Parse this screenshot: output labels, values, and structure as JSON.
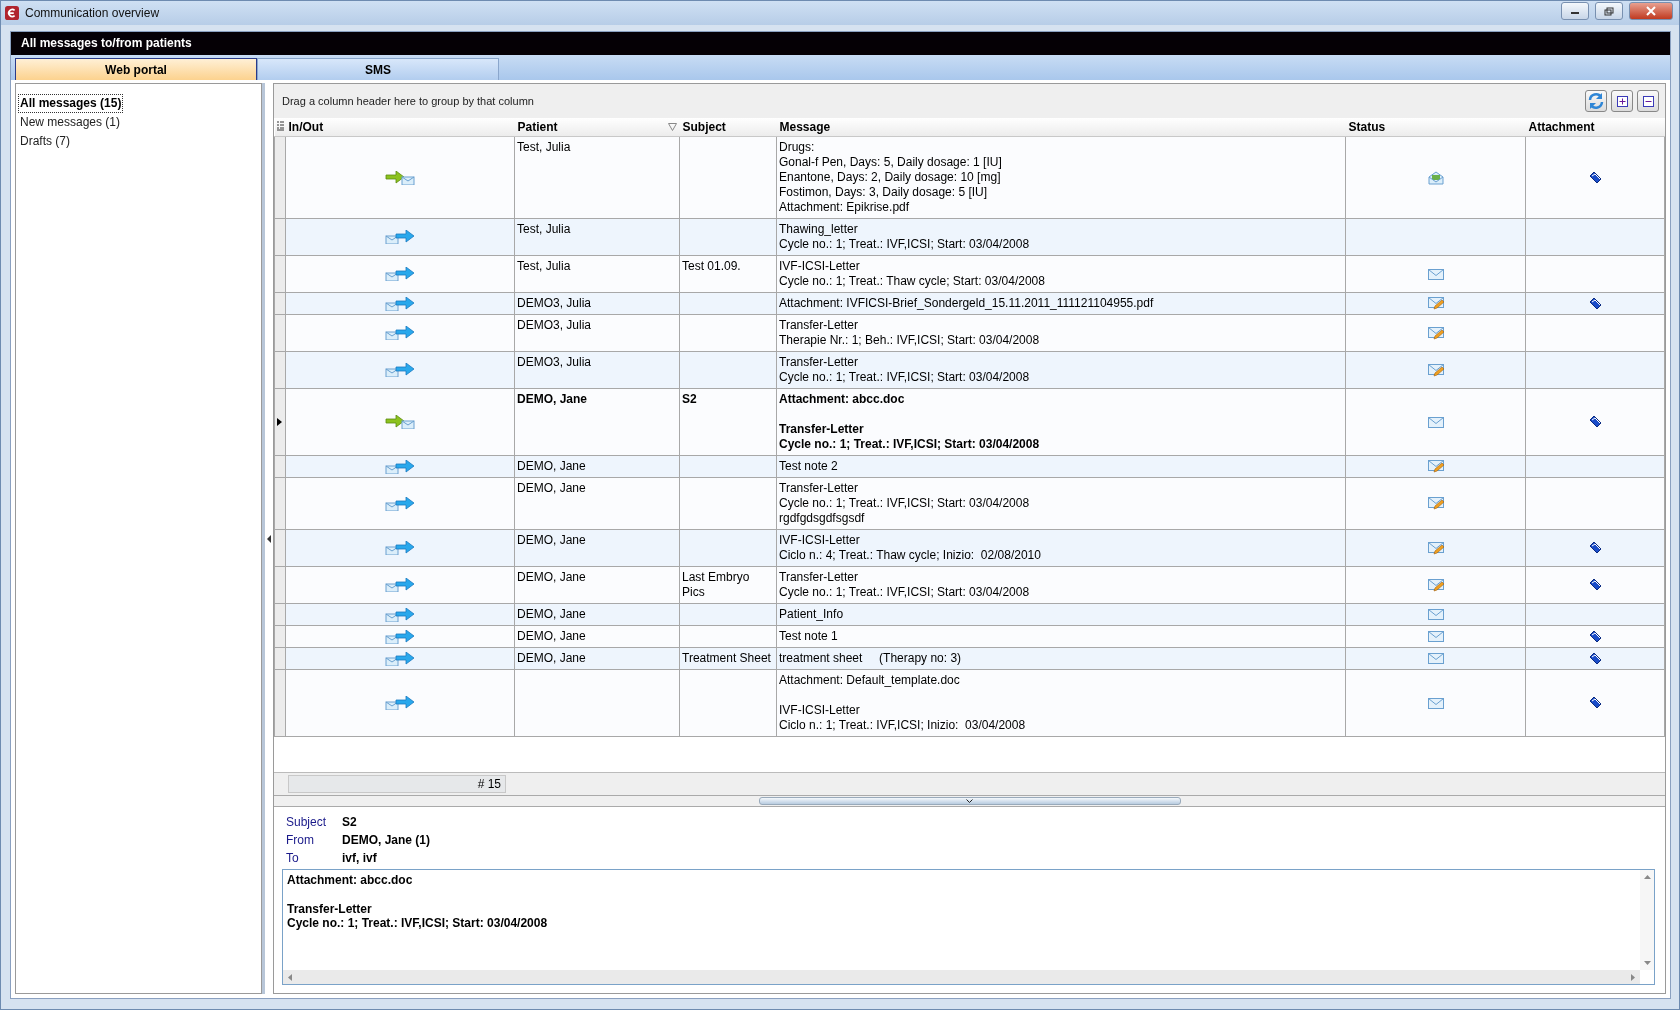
{
  "window": {
    "title": "Communication overview"
  },
  "header": "All messages to/from patients",
  "tabs": [
    {
      "label": "Web portal",
      "selected": true
    },
    {
      "label": "SMS",
      "selected": false
    }
  ],
  "folders": [
    {
      "label": "All messages (15)",
      "selected": true
    },
    {
      "label": "New messages (1)",
      "selected": false
    },
    {
      "label": "Drafts (7)",
      "selected": false
    }
  ],
  "group_hint": "Drag a column header here to group by that column",
  "table": {
    "columns": [
      "In/Out",
      "Patient",
      "Subject",
      "Message",
      "Status",
      "Attachment"
    ],
    "rows": [
      {
        "kind": "incoming",
        "patient": "Test, Julia",
        "message": [
          [
            "Drugs:",
            "Gonal-f Pen, Days: 5, Daily dosage: 1 [IU]",
            "Enantone, Days: 2, Daily dosage: 10 [mg]",
            "Fostimon, Days: 3, Daily dosage: 5 [IU]",
            "Attachment: Epikrise.pdf"
          ]
        ],
        "status": {
          "kind": "opened"
        },
        "attachment": true,
        "unread": false,
        "selected": false
      },
      {
        "kind": "outgoing",
        "patient": "Test, Julia",
        "message": [
          [
            "Thawing_letter",
            "Cycle no.: 1; Treat.: IVF,ICSI; Start: 03/04/2008"
          ]
        ],
        "attachment": false,
        "unread": false,
        "selected": false
      },
      {
        "kind": "outgoing",
        "patient": "Test, Julia",
        "subject": "Test 01.09.",
        "message": [
          [
            "IVF-ICSI-Letter",
            "Cycle no.: 1; Treat.: Thaw cycle; Start: 03/04/2008"
          ]
        ],
        "status": {
          "kind": "envelope"
        },
        "attachment": false,
        "unread": false,
        "selected": false
      },
      {
        "kind": "outgoing",
        "patient": "DEMO3, Julia",
        "message": [
          [
            "Attachment: IVFICSI-Brief_Sondergeld_15.11.2011_111121104955.pdf"
          ]
        ],
        "status": {
          "kind": "draft"
        },
        "attachment": true,
        "unread": false,
        "selected": false
      },
      {
        "kind": "outgoing",
        "patient": "DEMO3, Julia",
        "message": [
          [
            "Transfer-Letter",
            "Therapie Nr.: 1; Beh.: IVF,ICSI; Start: 03/04/2008"
          ]
        ],
        "status": {
          "kind": "draft"
        },
        "attachment": false,
        "unread": false,
        "selected": false
      },
      {
        "kind": "outgoing",
        "patient": "DEMO3, Julia",
        "message": [
          [
            "Transfer-Letter",
            "Cycle no.: 1; Treat.: IVF,ICSI; Start: 03/04/2008"
          ]
        ],
        "status": {
          "kind": "draft"
        },
        "attachment": false,
        "unread": false,
        "selected": false
      },
      {
        "kind": "incoming",
        "patient": "DEMO, Jane",
        "subject": "S2",
        "message": [
          [
            "Attachment: abcc.doc"
          ],
          [
            "Transfer-Letter",
            "Cycle no.: 1; Treat.: IVF,ICSI; Start: 03/04/2008"
          ]
        ],
        "status": {
          "kind": "envelope"
        },
        "attachment": true,
        "unread": true,
        "selected": true
      },
      {
        "kind": "outgoing",
        "patient": "DEMO, Jane",
        "message": [
          [
            "Test note 2"
          ]
        ],
        "status": {
          "kind": "draft"
        },
        "attachment": false,
        "unread": false,
        "selected": false
      },
      {
        "kind": "outgoing",
        "patient": "DEMO, Jane",
        "message": [
          [
            "Transfer-Letter",
            "Cycle no.: 1; Treat.: IVF,ICSI; Start: 03/04/2008",
            "rgdfgdsgdfsgsdf"
          ]
        ],
        "status": {
          "kind": "draft"
        },
        "attachment": false,
        "unread": false,
        "selected": false
      },
      {
        "kind": "outgoing",
        "patient": "DEMO, Jane",
        "message": [
          [
            "IVF-ICSI-Letter",
            "Ciclo n.: 4; Treat.: Thaw cycle; Inizio:  02/08/2010"
          ]
        ],
        "status": {
          "kind": "draft"
        },
        "attachment": true,
        "unread": false,
        "selected": false
      },
      {
        "kind": "outgoing",
        "patient": "DEMO, Jane",
        "subject": "Last Embryo Pics",
        "message": [
          [
            "Transfer-Letter",
            "Cycle no.: 1; Treat.: IVF,ICSI; Start: 03/04/2008"
          ]
        ],
        "status": {
          "kind": "draft"
        },
        "attachment": true,
        "unread": false,
        "selected": false
      },
      {
        "kind": "outgoing",
        "patient": "DEMO, Jane",
        "message": [
          [
            "Patient_Info"
          ]
        ],
        "status": {
          "kind": "envelope"
        },
        "attachment": false,
        "unread": false,
        "selected": false
      },
      {
        "kind": "outgoing",
        "patient": "DEMO, Jane",
        "message": [
          [
            "Test note 1"
          ]
        ],
        "status": {
          "kind": "envelope"
        },
        "attachment": true,
        "unread": false,
        "selected": false
      },
      {
        "kind": "outgoing",
        "patient": "DEMO, Jane",
        "subject": "Treatment Sheet",
        "message": [
          [
            "treatment sheet     (Therapy no: 3)"
          ]
        ],
        "status": {
          "kind": "envelope"
        },
        "attachment": true,
        "unread": false,
        "selected": false
      },
      {
        "kind": "outgoing",
        "message": [
          [
            "Attachment: Default_template.doc"
          ],
          [
            "IVF-ICSI-Letter",
            "Ciclo n.: 1; Treat.: IVF,ICSI; Inizio:  03/04/2008"
          ]
        ],
        "status": {
          "kind": "envelope"
        },
        "attachment": true,
        "unread": false,
        "selected": false
      }
    ],
    "count": "# 15"
  },
  "preview": {
    "fields": [
      {
        "label": "Subject",
        "value": "S2"
      },
      {
        "label": "From",
        "value": "DEMO, Jane (1)"
      },
      {
        "label": "To",
        "value": "ivf, ivf"
      }
    ],
    "body": [
      [
        "Attachment: abcc.doc"
      ],
      [
        "Transfer-Letter",
        "Cycle no.: 1; Treat.: IVF,ICSI; Start: 03/04/2008"
      ]
    ]
  }
}
